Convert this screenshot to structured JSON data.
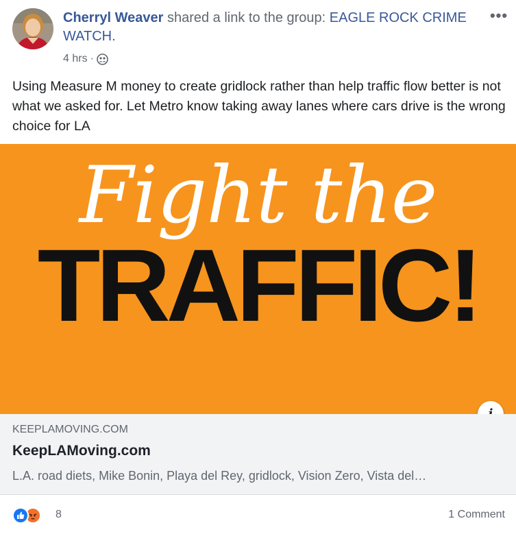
{
  "post": {
    "author_name": "Cherryl Weaver",
    "action_text": " shared a link to the group: ",
    "group_name": "EAGLE ROCK CRIME WATCH.",
    "timestamp": "4 hrs",
    "separator": "·",
    "privacy_icon": "group-icon",
    "more_label": "•••",
    "body_text": "Using Measure M money to create gridlock rather than help traffic flow better is not what we asked for. Let Metro know taking away lanes where cars drive is the wrong choice for LA"
  },
  "link_preview": {
    "image_line1": "Fight the",
    "image_line2": "TRAFFIC!",
    "image_background": "#f7941d",
    "info_label": "i",
    "domain": "KEEPLAMOVING.COM",
    "title": "KeepLAMoving.com",
    "description": "L.A. road diets, Mike Bonin, Playa del Rey, gridlock, Vision Zero, Vista del…"
  },
  "engagement": {
    "reaction_icons": [
      "like-icon",
      "angry-icon"
    ],
    "reaction_count": "8",
    "comment_count": "1 Comment"
  },
  "colors": {
    "link_blue": "#385898",
    "like_blue": "#1877f2",
    "angry_orange": "#f0722c"
  }
}
